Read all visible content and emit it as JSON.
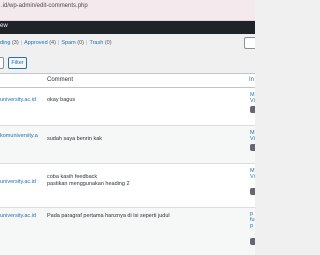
{
  "browser": {
    "url_fragment": ".id/wp-admin/edit-comments.php"
  },
  "admin_bar": {
    "fragment": "ew"
  },
  "filters": [
    {
      "label": "ding",
      "count": "(3)"
    },
    {
      "label": "Approved",
      "count": "(4)"
    },
    {
      "label": "Spam",
      "count": "(0)"
    },
    {
      "label": "Trash",
      "count": "(0)"
    }
  ],
  "toolbar": {
    "filter_label": "Filter"
  },
  "table": {
    "columns": {
      "comment": "Comment",
      "in_response": "In"
    },
    "rows": [
      {
        "author_fragment": "university.ac.id",
        "comment": "okay bagus",
        "comment_line2": "",
        "resp_line1": "M",
        "resp_line2": "Vi",
        "resp_line3": ""
      },
      {
        "author_fragment": "komuniversity.a",
        "comment": "sudah saya benrin kak",
        "comment_line2": "",
        "resp_line1": "M",
        "resp_line2": "Vi",
        "resp_line3": ""
      },
      {
        "author_fragment": "university.ac.id",
        "comment": "coba kasih feedback",
        "comment_line2": "pastikan menggunakan heading 2",
        "resp_line1": "M",
        "resp_line2": "Vi",
        "resp_line3": ""
      },
      {
        "author_fragment": "university.ac.id",
        "comment": "Pada paragraf pertama hanznya di isi seperti judul",
        "comment_line2": "",
        "resp_line1": "p",
        "resp_line2": "fu",
        "resp_line3": "p"
      }
    ]
  },
  "colors": {
    "link": "#2271b1",
    "admin_bar": "#1d2327",
    "text": "#2c3338",
    "bubble": "#646970"
  }
}
